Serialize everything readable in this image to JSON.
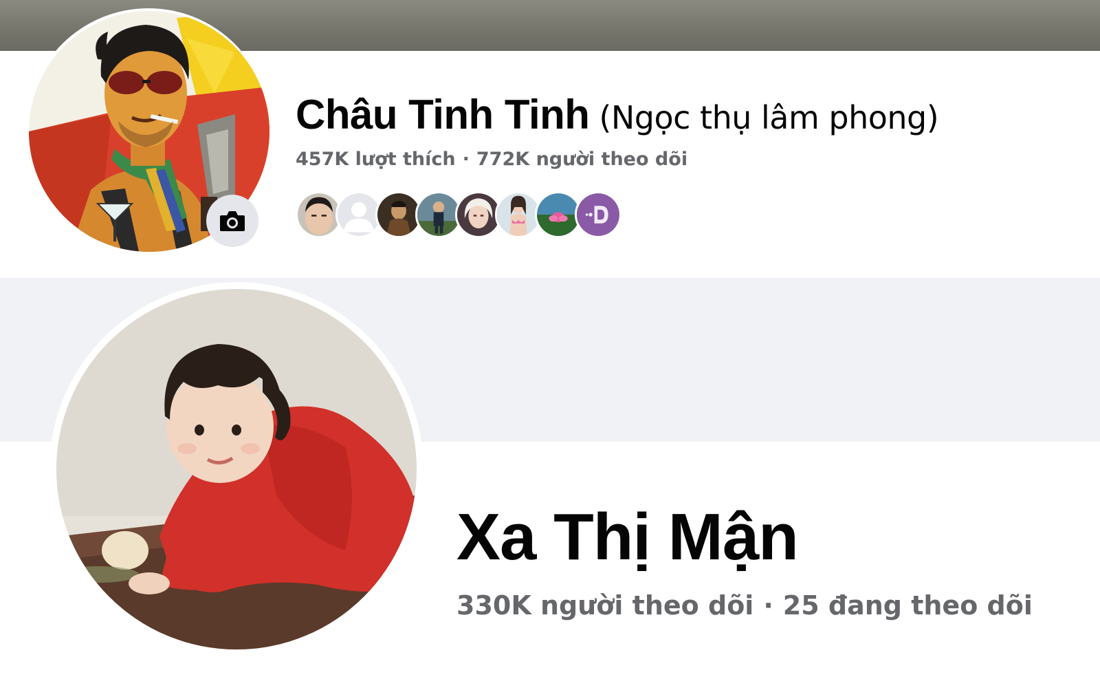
{
  "profiles": [
    {
      "name": "Châu Tinh Tinh",
      "alt_name": "(Ngọc thụ lâm phong)",
      "stats": {
        "likes": "457K lượt thích",
        "separator": "·",
        "followers": "772K người theo dõi"
      },
      "avatar_icon": "profile-avatar-illustration",
      "camera_icon": "camera-icon",
      "friend_avatars": [
        {
          "icon": "friend-avatar-boy"
        },
        {
          "icon": "friend-avatar-default"
        },
        {
          "icon": "friend-avatar-painting"
        },
        {
          "icon": "friend-avatar-child"
        },
        {
          "icon": "friend-avatar-girl"
        },
        {
          "icon": "friend-avatar-woman"
        },
        {
          "icon": "friend-avatar-lotus"
        },
        {
          "icon": "friend-avatar-logo"
        }
      ],
      "colors": {
        "cover": "#75756c",
        "background": "#ffffff"
      }
    },
    {
      "name": "Xa Thị Mận",
      "stats": {
        "followers": "330K người theo dõi",
        "separator": "·",
        "following": "25 đang theo dõi"
      },
      "avatar_icon": "profile-avatar-photo",
      "colors": {
        "cover": "#f0f2f5",
        "background": "#ffffff"
      }
    }
  ],
  "colors": {
    "name_text": "#050505",
    "secondary_text": "#65676b",
    "camera_button_bg": "#e4e6eb"
  }
}
